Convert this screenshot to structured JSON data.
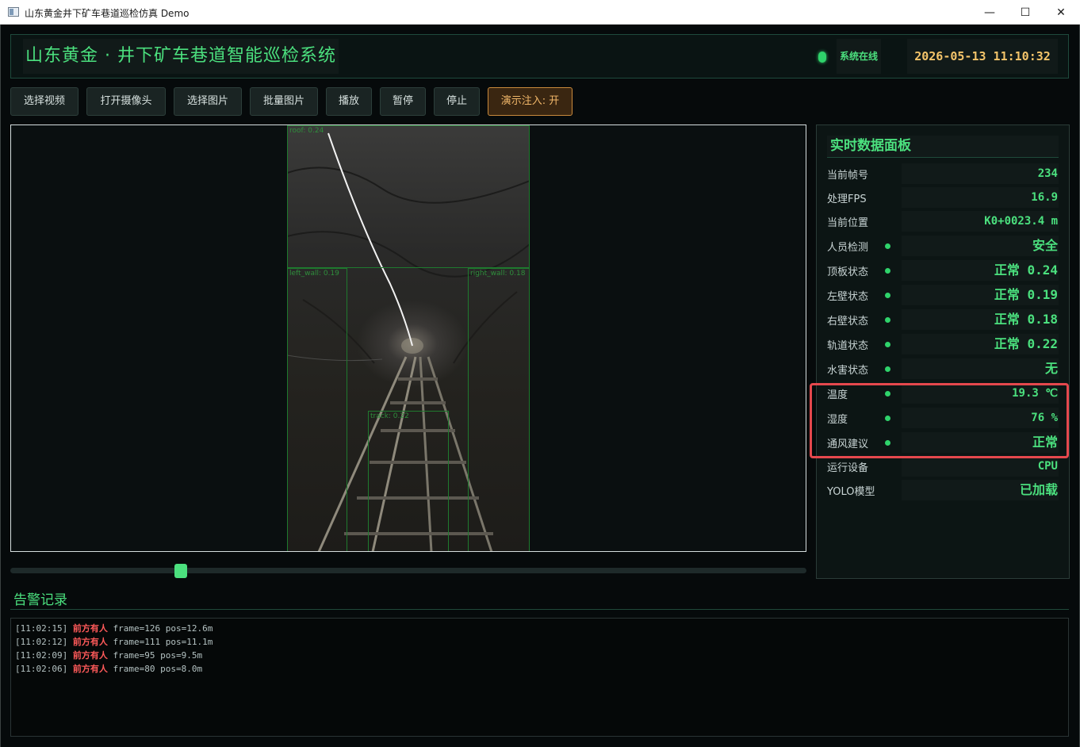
{
  "window": {
    "title": "山东黄金井下矿车巷道巡检仿真 Demo",
    "minimize": "—",
    "maximize": "☐",
    "close": "✕"
  },
  "header": {
    "brand": "山东黄金 · 井下矿车巷道智能巡检系统",
    "status": "系统在线",
    "datetime": "2026-05-13 11:10:32"
  },
  "toolbar": {
    "select_video": "选择视频",
    "open_camera": "打开摄像头",
    "select_image": "选择图片",
    "batch_image": "批量图片",
    "play": "播放",
    "pause": "暂停",
    "stop": "停止",
    "demo_inject": "演示注入: 开"
  },
  "detections": {
    "roof": "roof: 0.24",
    "left_wall": "left_wall: 0.19",
    "right_wall": "right_wall: 0.18",
    "track": "track: 0.22"
  },
  "playback": {
    "progress": 0.21
  },
  "panel": {
    "title": "实时数据面板",
    "frame_label": "当前帧号",
    "frame_value": "234",
    "fps_label": "处理FPS",
    "fps_value": "16.9",
    "pos_label": "当前位置",
    "pos_value": "K0+0023.4 m",
    "person_label": "人员检测",
    "person_value": "安全",
    "roof_label": "顶板状态",
    "roof_value": "正常 0.24",
    "lwall_label": "左壁状态",
    "lwall_value": "正常 0.19",
    "rwall_label": "右壁状态",
    "rwall_value": "正常 0.18",
    "track_label": "轨道状态",
    "track_value": "正常 0.22",
    "water_label": "水害状态",
    "water_value": "无",
    "temp_label": "温度",
    "temp_value": "19.3 ℃",
    "hum_label": "湿度",
    "hum_value": "76 %",
    "vent_label": "通风建议",
    "vent_value": "正常",
    "device_label": "运行设备",
    "device_value": "CPU",
    "model_label": "YOLO模型",
    "model_value": "已加载"
  },
  "alarm": {
    "title": "告警记录",
    "entries": [
      {
        "time": "[11:02:15]",
        "msg": "前方有人",
        "detail": "frame=126 pos=12.6m"
      },
      {
        "time": "[11:02:12]",
        "msg": "前方有人",
        "detail": "frame=111 pos=11.1m"
      },
      {
        "time": "[11:02:09]",
        "msg": "前方有人",
        "detail": "frame=95 pos=9.5m"
      },
      {
        "time": "[11:02:06]",
        "msg": "前方有人",
        "detail": "frame=80 pos=8.0m"
      }
    ]
  },
  "colors": {
    "accent_green": "#4be07e",
    "alert_red": "#ff5a5a",
    "clock_amber": "#f4c46a",
    "highlight_red": "#e5484d"
  }
}
